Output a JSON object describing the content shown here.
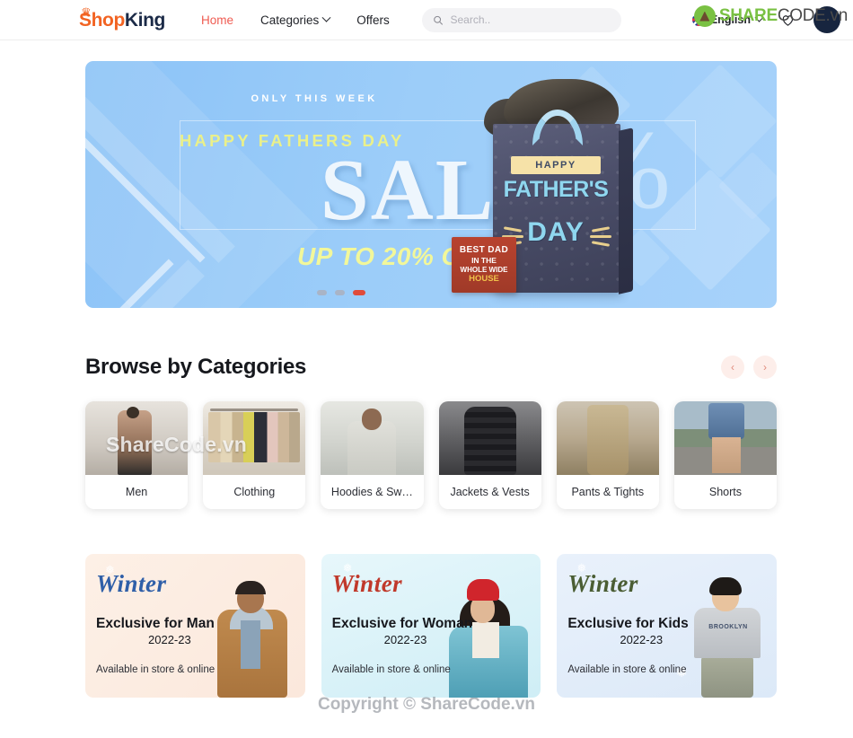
{
  "header": {
    "logo": {
      "part1": "Shop",
      "part2": "King",
      "crown_icon": "crown-icon"
    },
    "nav": [
      {
        "label": "Home",
        "active": true
      },
      {
        "label": "Categories",
        "active": false,
        "has_dropdown": true
      },
      {
        "label": "Offers",
        "active": false
      }
    ],
    "search": {
      "placeholder": "Search..",
      "value": "",
      "icon": "search-icon"
    },
    "language": {
      "label": "English",
      "flag_icon": "uk-flag-icon",
      "caret_icon": "chevron-down-icon"
    },
    "wishlist_icon": "heart-icon",
    "account_icon": "avatar-icon",
    "watermark_logo": {
      "part1": "SHARE",
      "part2": "CODE.vn",
      "icon": "sharecode-recycle-icon"
    }
  },
  "banner": {
    "eyebrow": "ONLY THIS WEEK",
    "occasion": "HAPPY FATHERS DAY",
    "headline": "SALE",
    "subline": "UP TO 20% OFF",
    "percent_glyph": "%",
    "gift_bag": {
      "tag": "HAPPY",
      "line1": "FATHER'S",
      "line2": "DAY"
    },
    "sign": {
      "line1": "BEST DAD",
      "line2": "IN THE",
      "line3": "WHOLE WIDE",
      "line4": "HOUSE"
    },
    "dots": [
      {
        "active": false
      },
      {
        "active": false
      },
      {
        "active": true
      }
    ]
  },
  "categories_section": {
    "title": "Browse by Categories",
    "prev_label": "‹",
    "next_label": "›",
    "watermark": "ShareCode.vn",
    "items": [
      {
        "label": "Men",
        "photo": "ph-men"
      },
      {
        "label": "Clothing",
        "photo": "ph-cloth"
      },
      {
        "label": "Hoodies & Sw…",
        "photo": "ph-hood"
      },
      {
        "label": "Jackets & Vests",
        "photo": "ph-jacket"
      },
      {
        "label": "Pants & Tights",
        "photo": "ph-pants"
      },
      {
        "label": "Shorts",
        "photo": "ph-shorts"
      }
    ]
  },
  "promos": [
    {
      "script": "Winter",
      "title": "Exclusive for Man",
      "year": "2022-23",
      "subtitle": "Available in store & online"
    },
    {
      "script": "Winter",
      "title": "Exclusive for Woman",
      "year": "2022-23",
      "subtitle": "Available in store & online"
    },
    {
      "script": "Winter",
      "title": "Exclusive for Kids",
      "year": "2022-23",
      "subtitle": "Available in store & online"
    }
  ],
  "footer_watermark": "Copyright © ShareCode.vn",
  "colors": {
    "brand_orange": "#f26322",
    "brand_navy": "#1b2a47",
    "accent_coral": "#ef5b51",
    "banner_blue": "#9ccdf9",
    "banner_yellow": "#eaf08a",
    "dot_active": "#e04b3a",
    "sharecode_green": "#7ac143"
  }
}
